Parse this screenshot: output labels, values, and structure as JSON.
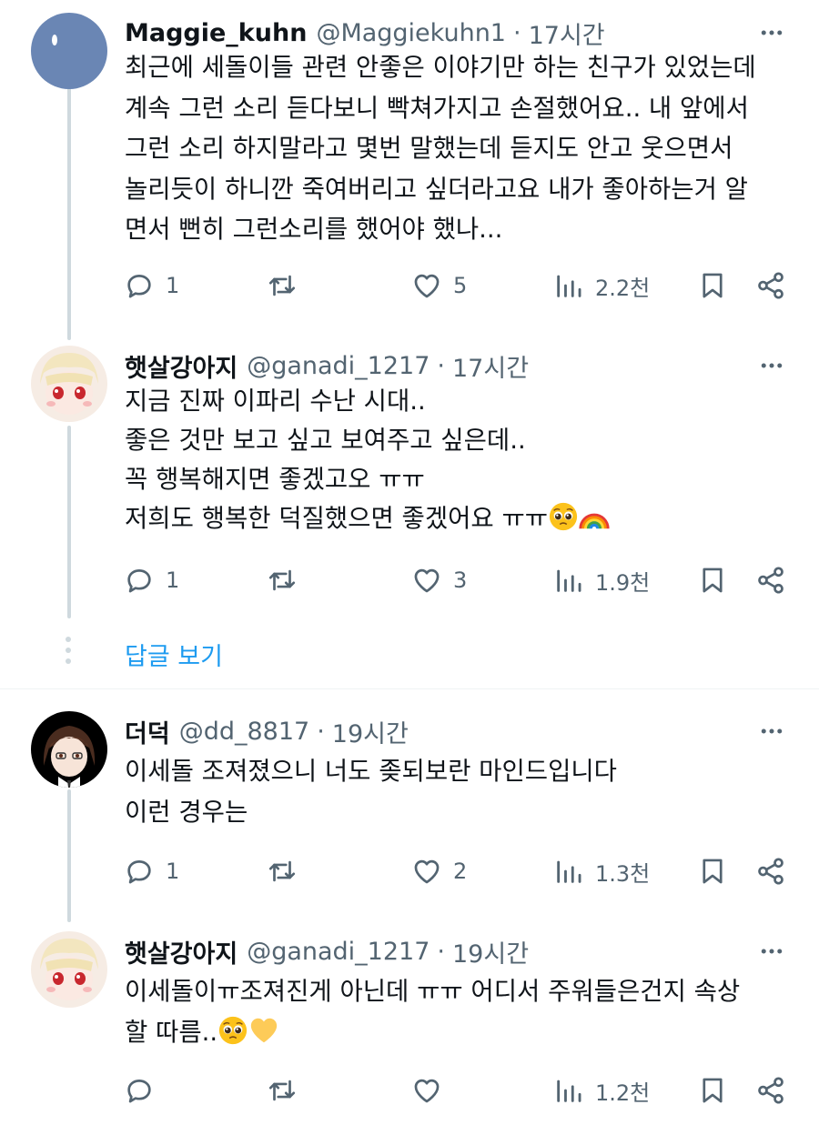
{
  "tweets": [
    {
      "display_name": "Maggie_kuhn",
      "handle": "@Maggiekuhn1",
      "separator": "·",
      "time": "17시간",
      "avatar": "blue-default-avatar",
      "lines": [
        "최근에 세돌이들 관련 안좋은 이야기만 하는 친구가 있었는데",
        "계속 그런 소리 듣다보니 빡쳐가지고 손절했어요.. 내 앞에서",
        "그런 소리 하지말라고 몇번 말했는데 듣지도 안고 웃으면서",
        "놀리듯이 하니깐 죽여버리고 싶더라고요 내가 좋아하는거 알",
        "면서 뻔히 그런소리를 했어야 했나..."
      ],
      "replies": "1",
      "retweets": "",
      "likes": "5",
      "views": "2.2천"
    },
    {
      "display_name": "햇살강아지",
      "handle": "@ganadi_1217",
      "separator": "·",
      "time": "17시간",
      "avatar": "anime-girl-avatar",
      "lines": [
        "지금 진짜 이파리 수난 시대..",
        "좋은 것만 보고 싶고 보여주고 싶은데..",
        "꼭 행복해지면 좋겠고오 ㅠㅠ",
        "저희도 행복한 덕질했으면 좋겠어요 ㅠㅠ"
      ],
      "emojis": [
        "pleading-face-emoji",
        "rainbow-emoji"
      ],
      "replies": "1",
      "retweets": "",
      "likes": "3",
      "views": "1.9천"
    },
    {
      "display_name": "더덕",
      "handle": "@dd_8817",
      "separator": "·",
      "time": "19시간",
      "avatar": "anime-boy-avatar",
      "lines": [
        "이세돌 조져졌으니 너도 좆되보란 마인드입니다",
        "이런 경우는"
      ],
      "replies": "1",
      "retweets": "",
      "likes": "2",
      "views": "1.3천"
    },
    {
      "display_name": "햇살강아지",
      "handle": "@ganadi_1217",
      "separator": "·",
      "time": "19시간",
      "avatar": "anime-girl-avatar",
      "lines": [
        "이세돌이ㅠ조져진게 아닌데 ㅠㅠ 어디서 주워들은건지 속상",
        "할 따름.."
      ],
      "emojis": [
        "pleading-face-emoji",
        "yellow-heart-emoji"
      ],
      "replies": "",
      "retweets": "",
      "likes": "",
      "views": "1.2천"
    }
  ],
  "show_replies_label": "답글 보기",
  "colors": {
    "text": "#0f1419",
    "secondary": "#536471",
    "link": "#1d9bf0",
    "thread_line": "#cfd9de",
    "divider": "#eff3f4"
  }
}
